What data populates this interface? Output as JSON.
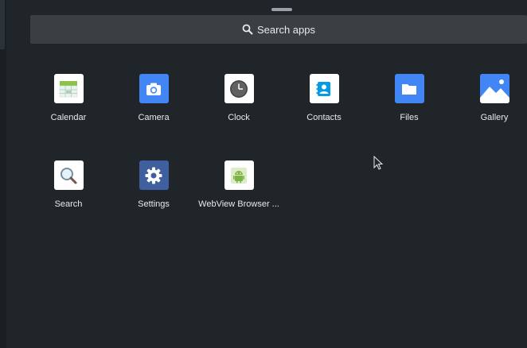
{
  "search": {
    "label": "Search apps",
    "icon": "search-icon"
  },
  "apps": [
    {
      "name": "Calendar",
      "icon": "calendar-icon"
    },
    {
      "name": "Camera",
      "icon": "camera-icon"
    },
    {
      "name": "Clock",
      "icon": "clock-icon"
    },
    {
      "name": "Contacts",
      "icon": "contacts-icon"
    },
    {
      "name": "Files",
      "icon": "folder-icon"
    },
    {
      "name": "Gallery",
      "icon": "gallery-icon"
    },
    {
      "name": "Search",
      "icon": "magnifier-icon"
    },
    {
      "name": "Settings",
      "icon": "gear-icon"
    },
    {
      "name": "WebView Browser ...",
      "icon": "android-icon"
    }
  ],
  "colors": {
    "background": "#202529",
    "search_bar": "#3a3f43",
    "text": "#e8eaed",
    "camera_blue": "#4285f4",
    "settings_blue": "#3f5f9f",
    "android_green": "#7cb342"
  }
}
